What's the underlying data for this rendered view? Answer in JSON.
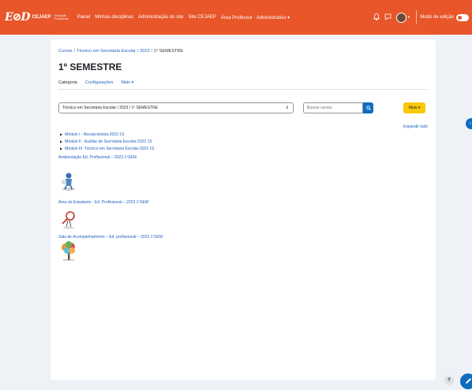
{
  "navbar": {
    "logo_mark": "E⊘D",
    "logo_word": "CEJAEP",
    "logo_sub_1": "Educação",
    "logo_sub_2": "Profissional",
    "links": [
      "Painel",
      "Minhas disciplinas",
      "Administração do site",
      "Site CEJAEP",
      "Área Professor - Administrativo ▾"
    ],
    "edit_mode_label": "Modo de edição",
    "notification_icon": "bell-icon",
    "messages_icon": "chat-icon",
    "user_menu_caret": "▾"
  },
  "breadcrumb": {
    "items": [
      "Cursos",
      "Técnico em Secretaria Escolar",
      "2023",
      "1º SEMESTRE"
    ],
    "separator": "/"
  },
  "page_title": "1º SEMESTRE",
  "tabs": [
    {
      "label": "Categoria",
      "active": true
    },
    {
      "label": "Configurações",
      "active": false
    },
    {
      "label": "Mais ▾",
      "active": false
    }
  ],
  "category_select": {
    "value": "Técnico em Secretaria Escolar / 2023 / 1º SEMESTRE"
  },
  "search": {
    "placeholder": "Buscar cursos"
  },
  "mais_button": "Mais ▾",
  "expand_all": "Expandir tudo",
  "subcategories": [
    "Módulo I - Recepcionista-2023 1S",
    "Módulo II - Auxiliar de Secretaria Escolar-2023 1S",
    "Módulo III -Técnico em Secretaria Escolar-2023 1S"
  ],
  "courses": [
    {
      "name": "Ambientação Ed. Profissional – 2023 1ºSEM",
      "image": "person-figure-image"
    },
    {
      "name": "Área do Estudante - Ed. Profissional – 2023 1ºSEM",
      "image": "magnifier-figure-image"
    },
    {
      "name": "Sala de Acompanhamento – Ed. profissional – 2023 1ºSEM",
      "image": "tree-image"
    }
  ],
  "help_button": "?",
  "colors": {
    "navbar": "#e8562a",
    "link": "#1f5fbf",
    "primary": "#0f6cbf",
    "warning": "#f8c90a"
  }
}
